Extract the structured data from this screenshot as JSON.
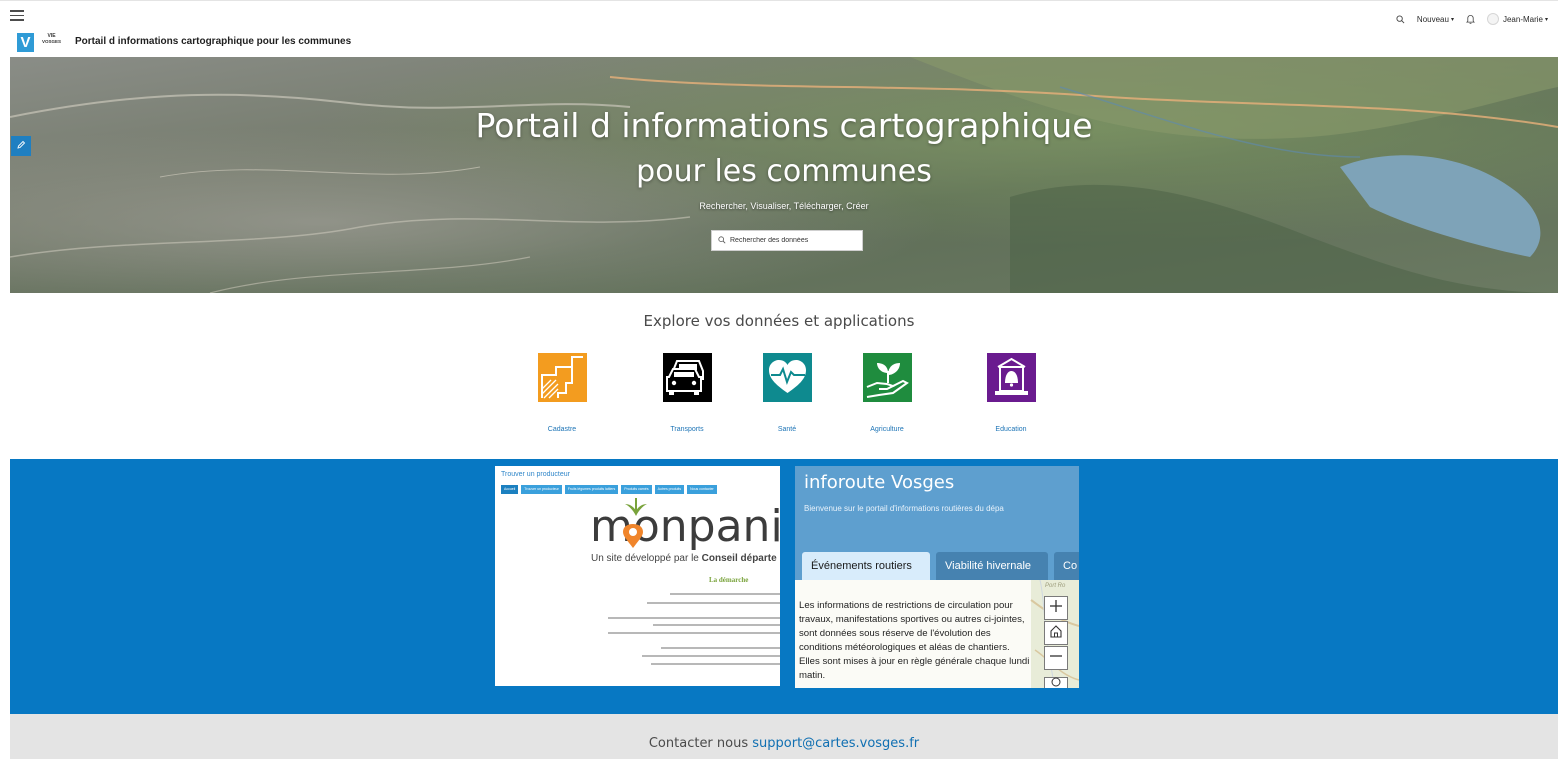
{
  "header": {
    "site_title": "Portail d informations cartographique pour les communes",
    "logo_letter": "V",
    "logo_text_top": "VIE",
    "logo_text_bottom": "VOSGES",
    "nav": {
      "new_label": "Nouveau",
      "user_label": "Jean-Marie"
    },
    "icons": [
      "menu-icon",
      "search-icon",
      "bell-icon",
      "user-icon",
      "chevron-down-icon"
    ]
  },
  "hero": {
    "title_line1": "Portail d informations cartographique",
    "title_line2": "pour les communes",
    "subtitle": "Rechercher, Visualiser, Télécharger, Créer",
    "search_placeholder": "Rechercher des données"
  },
  "explore": {
    "title": "Explore vos données et applications",
    "tiles": [
      {
        "label": "Cadastre",
        "color": "#f39c1f",
        "icon": "cadastre-icon"
      },
      {
        "label": "Transports",
        "color": "#000000",
        "icon": "car-icon"
      },
      {
        "label": "Santé",
        "color": "#0e8a8f",
        "icon": "heart-icon"
      },
      {
        "label": "Agriculture",
        "color": "#1f8c3e",
        "icon": "plant-icon"
      },
      {
        "label": "Education",
        "color": "#6a1b8f",
        "icon": "school-icon"
      }
    ]
  },
  "cards": {
    "monpanier": {
      "top_label": "Trouver un producteur",
      "tabs": [
        "Accueil",
        "Trouver un producteur",
        "Fruits légumes produits laitiers",
        "Produits carnés",
        "Autres produits",
        "Nous contacter"
      ],
      "logo_text": "monpanier",
      "developed_by_prefix": "Un site développé par le ",
      "developed_by_bold": "Conseil départe",
      "section_title": "La démarche"
    },
    "inforoute": {
      "title": "inforoute Vosges",
      "subtitle": "Bienvenue sur le portail d'informations routières du dépa",
      "tabs": [
        "Événements routiers",
        "Viabilité hivernale",
        "Co"
      ],
      "text": "Les informations de restrictions de circulation pour travaux, manifestations sportives ou autres ci-jointes, sont données sous réserve de l'évolution des conditions météorologiques et aléas de chantiers. Elles sont mises à jour en règle générale chaque lundi matin.",
      "map_label": "Port Ro"
    }
  },
  "footer": {
    "prefix": "Contacter nous ",
    "email": "support@cartes.vosges.fr"
  },
  "colors": {
    "accent_blue": "#0778c3",
    "link_blue": "#1d74b6",
    "footer_bg": "#e4e4e4"
  }
}
